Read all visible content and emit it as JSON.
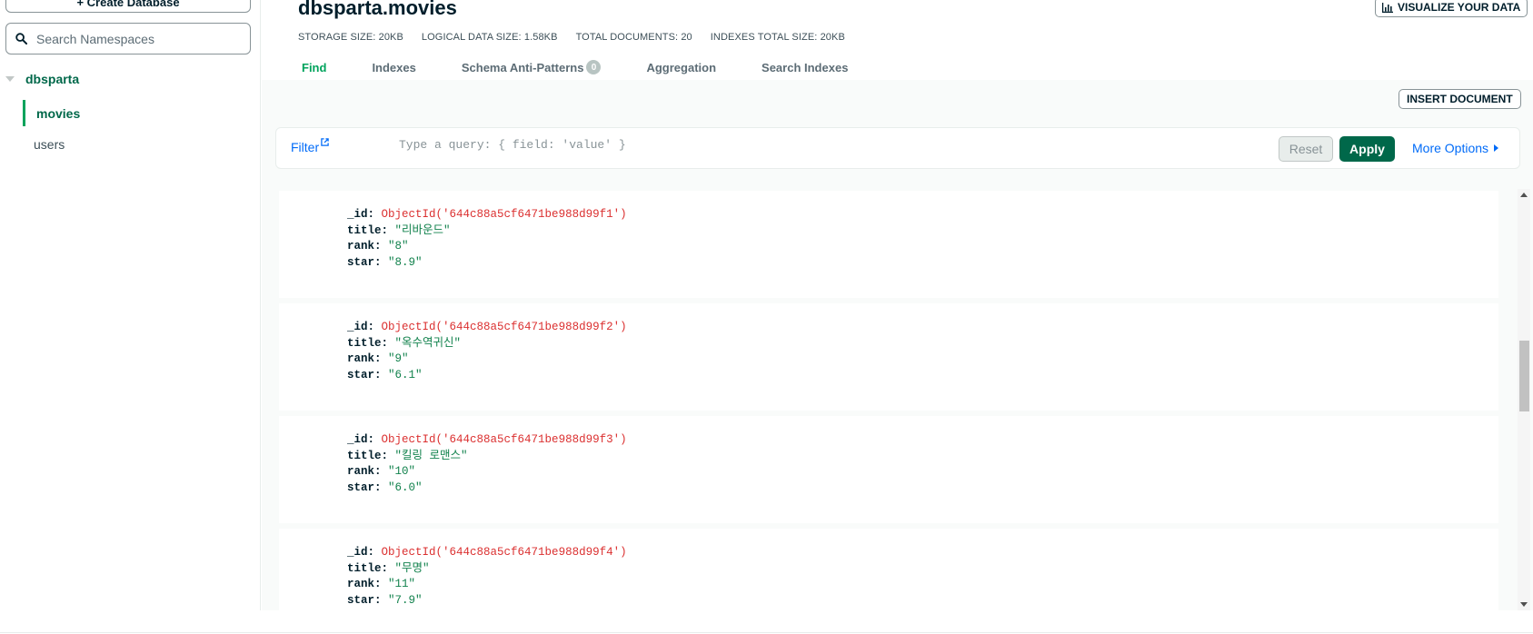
{
  "sidebar": {
    "create_database_label": "+ Create Database",
    "search": {
      "placeholder": "Search Namespaces"
    },
    "database": "dbsparta",
    "collections": [
      "movies",
      "users"
    ],
    "active_collection": "movies"
  },
  "header": {
    "title": "dbsparta.movies",
    "visualize_label": "VISUALIZE YOUR DATA",
    "stats": [
      "STORAGE SIZE: 20KB",
      "LOGICAL DATA SIZE: 1.58KB",
      "TOTAL DOCUMENTS: 20",
      "INDEXES TOTAL SIZE: 20KB"
    ],
    "tabs": [
      {
        "label": "Find",
        "active": true
      },
      {
        "label": "Indexes"
      },
      {
        "label": "Schema Anti-Patterns",
        "badge": "0"
      },
      {
        "label": "Aggregation"
      },
      {
        "label": "Search Indexes"
      }
    ]
  },
  "toolbar": {
    "insert_label": "INSERT DOCUMENT",
    "filter_label": "Filter",
    "query_placeholder": "Type a query: { field: 'value' }",
    "reset_label": "Reset",
    "apply_label": "Apply",
    "more_options_label": "More Options"
  },
  "documents": [
    {
      "id": "ObjectId('644c88a5cf6471be988d99f1')",
      "title": "\"리바운드\"",
      "rank": "\"8\"",
      "star": "\"8.9\""
    },
    {
      "id": "ObjectId('644c88a5cf6471be988d99f2')",
      "title": "\"옥수역귀신\"",
      "rank": "\"9\"",
      "star": "\"6.1\""
    },
    {
      "id": "ObjectId('644c88a5cf6471be988d99f3')",
      "title": "\"킬링 로맨스\"",
      "rank": "\"10\"",
      "star": "\"6.0\""
    },
    {
      "id": "ObjectId('644c88a5cf6471be988d99f4')",
      "title": "\"무명\"",
      "rank": "\"11\"",
      "star": "\"7.9\""
    }
  ],
  "field_keys": {
    "id": "_id:",
    "title": "title:",
    "rank": "rank:",
    "star": "star:"
  },
  "colors": {
    "accent": "#00684a",
    "active_tab": "#00a35c",
    "link": "#016bf8",
    "objectid": "#db3030",
    "string": "#12824d"
  }
}
